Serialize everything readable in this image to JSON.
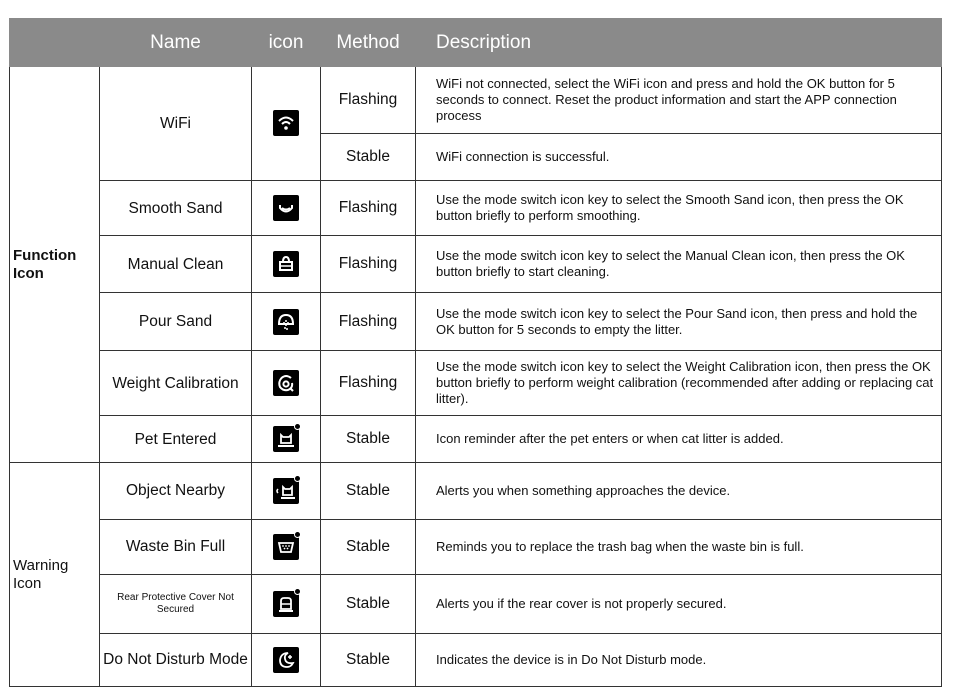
{
  "header": {
    "category": "",
    "name": "Name",
    "icon": "icon",
    "method": "Method",
    "description": "Description"
  },
  "groups": {
    "function": {
      "label": "Function Icon"
    },
    "warning": {
      "label": "Warning Icon"
    }
  },
  "rows": [
    {
      "name": "WiFi",
      "icon": "wifi-icon",
      "method": "Flashing",
      "description": "WiFi not connected, select the WiFi icon and press and hold the OK button for 5 seconds to connect. Reset the product information and start the APP connection process"
    },
    {
      "name": "",
      "icon": "",
      "method": "Stable",
      "description": "WiFi connection is successful."
    },
    {
      "name": "Smooth Sand",
      "icon": "smooth-sand-icon",
      "method": "Flashing",
      "description": "Use the mode switch icon key to select the Smooth Sand icon, then press the OK button briefly to perform smoothing."
    },
    {
      "name": "Manual Clean",
      "icon": "manual-clean-icon",
      "method": "Flashing",
      "description": "Use the mode switch icon key to select the Manual Clean icon, then press the OK button briefly to start cleaning."
    },
    {
      "name": "Pour Sand",
      "icon": "pour-sand-icon",
      "method": "Flashing",
      "description": "Use the mode switch icon key to select the Pour Sand icon, then press and hold the OK button for 5 seconds to empty the litter."
    },
    {
      "name": "Weight Calibration",
      "icon": "weight-calibration-icon",
      "method": "Flashing",
      "description": "Use the mode switch icon key to select the Weight Calibration icon, then press the OK button briefly to perform weight calibration (recommended after adding or replacing cat litter)."
    },
    {
      "name": "Pet Entered",
      "icon": "pet-entered-icon",
      "method": "Stable",
      "description": "Icon reminder after the pet enters or when cat litter is added."
    },
    {
      "name": "Object Nearby",
      "icon": "object-nearby-icon",
      "method": "Stable",
      "description": "Alerts you when something approaches the device."
    },
    {
      "name": "Waste Bin Full",
      "icon": "waste-bin-full-icon",
      "method": "Stable",
      "description": "Reminds you to replace the trash bag when the waste bin is full."
    },
    {
      "name": "Rear Protective Cover Not Secured",
      "icon": "rear-cover-icon",
      "method": "Stable",
      "description": "Alerts you if the rear cover is not properly secured."
    },
    {
      "name": "Do Not Disturb Mode",
      "icon": "do-not-disturb-icon",
      "method": "Stable",
      "description": "Indicates the device is in Do Not Disturb mode."
    }
  ]
}
